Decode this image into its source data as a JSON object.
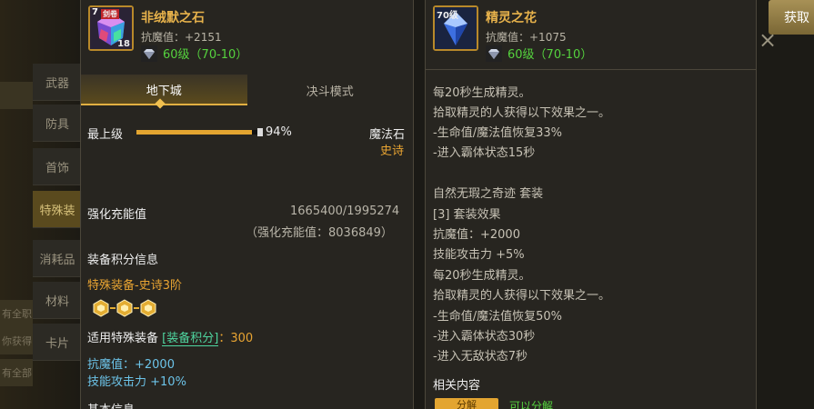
{
  "background": {
    "side_tabs": [
      "武器",
      "防具",
      "首饰",
      "特殊装",
      "消耗品",
      "材料",
      "卡片"
    ],
    "side_edges": [
      "",
      "有全职",
      "你获得",
      "有全部",
      "有全点",
      "获得新",
      "获得新"
    ],
    "get_button": "获取",
    "close_glyph": "×"
  },
  "left": {
    "item_name": "非绒默之石",
    "icon_badge": "7",
    "icon_tag": "剑卷",
    "icon_count": "18",
    "magic_resist": "抗魔值：+2151",
    "level": "60级（70-10）",
    "tabs": [
      "地下城",
      "决斗模式"
    ],
    "active_tab": 0,
    "grade_label": "最上级",
    "grade_percent": "94%",
    "grade_fraction": 0.94,
    "item_type": "魔法石",
    "rarity": "史诗",
    "enhance_label": "强化充能值",
    "enhance_value": "1665400/1995274",
    "enhance_total": "（强化充能值：8036849）",
    "score_title": "装备积分信息",
    "special_equip": "特殊装备-史诗3阶",
    "score_prefix": "适用特殊装备",
    "score_tag": "[装备积分]",
    "score_value": "：300",
    "bonus1": "抗魔值：+2000",
    "bonus2": "技能攻击力 +10%",
    "basic_info": "基本信息"
  },
  "right": {
    "item_name": "精灵之花",
    "icon_badge": "70级",
    "magic_resist": "抗魔值：+1075",
    "level": "60级（70-10）",
    "lines": [
      "每20秒生成精灵。",
      "拾取精灵的人获得以下效果之一。",
      "-生命值/魔法值恢复33%",
      "-进入霸体状态15秒",
      "",
      "自然无瑕之奇迹  套装",
      "[3] 套装效果",
      "抗魔值：+2000",
      "技能攻击力 +5%",
      "每20秒生成精灵。",
      "拾取精灵的人获得以下效果之一。",
      "-生命值/魔法值恢复50%",
      "-进入霸体状态30秒",
      "-进入无敌状态7秒"
    ],
    "related_title": "相关内容",
    "decompose_btn": "分解",
    "decompose_note": "可以分解"
  },
  "colors": {
    "gold": "#e7b24b",
    "green": "#55d23e",
    "blue": "#6cc3e8",
    "orange": "#e8a432"
  }
}
